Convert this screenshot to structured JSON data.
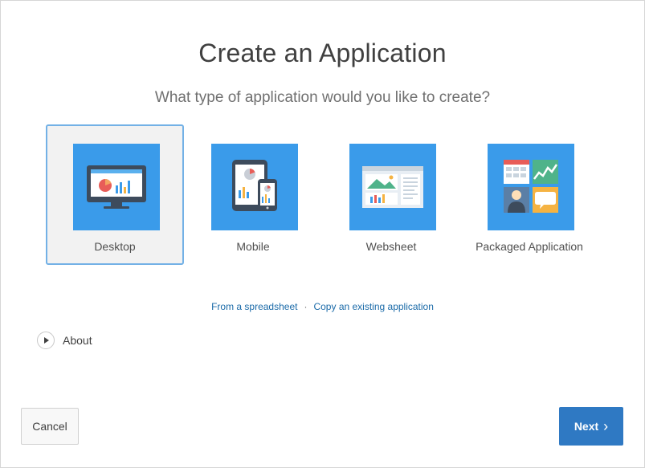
{
  "title": "Create an Application",
  "subtitle": "What type of application would you like to create?",
  "app_types": [
    {
      "label": "Desktop",
      "icon": "desktop-icon",
      "selected": true
    },
    {
      "label": "Mobile",
      "icon": "mobile-devices-icon",
      "selected": false
    },
    {
      "label": "Websheet",
      "icon": "websheet-icon",
      "selected": false
    },
    {
      "label": "Packaged Application",
      "icon": "packaged-application-icon",
      "selected": false
    }
  ],
  "links": {
    "spreadsheet": "From a spreadsheet",
    "separator": "·",
    "copy_existing": "Copy an existing application"
  },
  "about": {
    "label": "About"
  },
  "buttons": {
    "cancel": "Cancel",
    "next": "Next",
    "next_chevron": "›"
  },
  "colors": {
    "tile": "#3a9bea",
    "selected_border": "#73b1e6",
    "primary_button": "#2f79c3",
    "link": "#1a6aa8"
  }
}
